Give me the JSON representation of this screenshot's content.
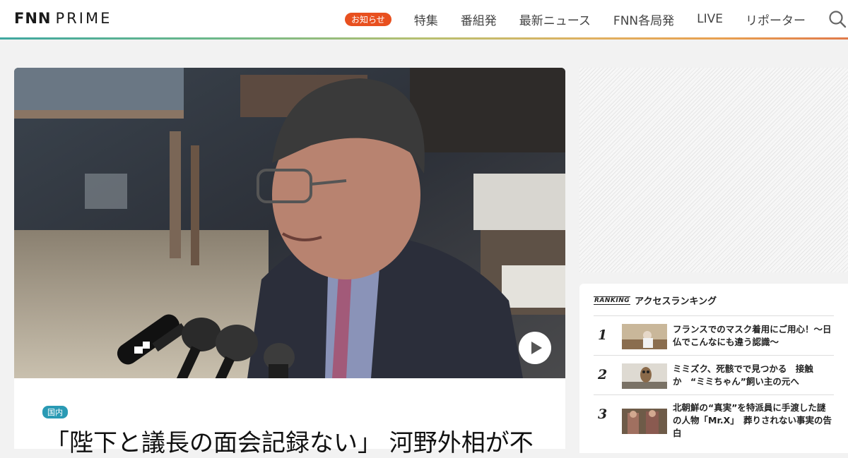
{
  "header": {
    "logo_main": "FNN",
    "logo_sub": "PRIME",
    "notice_label": "お知らせ",
    "nav": [
      "特集",
      "番組発",
      "最新ニュース",
      "FNN各局発",
      "LIVE",
      "リポーター"
    ],
    "search_icon": "search-icon"
  },
  "hero": {
    "image": "photo-minister-speaking-at-microphones",
    "play_icon": "play-icon"
  },
  "article": {
    "tag": "国内",
    "headline": "「陛下と議長の面会記録ない」 河野外相が不"
  },
  "ad": {
    "placeholder": "advertisement"
  },
  "ranking": {
    "badge": "RANKING",
    "title": "アクセスランキング",
    "items": [
      {
        "rank": "1",
        "title": "フランスでのマスク着用にご用心！～日仏でこんなにも違う認識～"
      },
      {
        "rank": "2",
        "title": "ミミズク、死骸でで見つかる　接触か　“ミミちゃん”飼い主の元へ"
      },
      {
        "rank": "3",
        "title": "北朝鮮の“真実”を特派員に手渡した謎の人物「Mr.X」　葬りされない事実の告白"
      }
    ]
  },
  "colors": {
    "accent_orange": "#e8501f",
    "tag_blue": "#2a9ab4"
  }
}
